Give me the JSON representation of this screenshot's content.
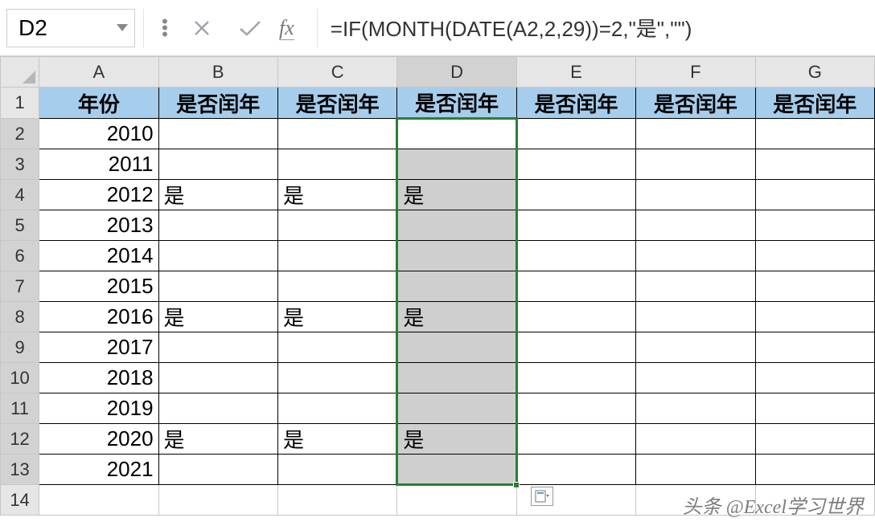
{
  "name_box": "D2",
  "formula_bar": "=IF(MONTH(DATE(A2,2,29))=2,\"是\",\"\")",
  "fx_label": "fx",
  "icons": {
    "cancel": "cancel-icon",
    "confirm": "confirm-icon",
    "dropdown": "dropdown-icon",
    "paste_options": "paste-options-icon"
  },
  "columns": [
    "A",
    "B",
    "C",
    "D",
    "E",
    "F",
    "G"
  ],
  "active_column": "D",
  "row_count": 14,
  "header_row": {
    "A": "年份",
    "B": "是否闰年",
    "C": "是否闰年",
    "D": "是否闰年",
    "E": "是否闰年",
    "F": "是否闰年",
    "G": "是否闰年"
  },
  "data_rows": [
    {
      "A": "2010",
      "B": "",
      "C": "",
      "D": "",
      "E": "",
      "F": "",
      "G": ""
    },
    {
      "A": "2011",
      "B": "",
      "C": "",
      "D": "",
      "E": "",
      "F": "",
      "G": ""
    },
    {
      "A": "2012",
      "B": "是",
      "C": "是",
      "D": "是",
      "E": "",
      "F": "",
      "G": ""
    },
    {
      "A": "2013",
      "B": "",
      "C": "",
      "D": "",
      "E": "",
      "F": "",
      "G": ""
    },
    {
      "A": "2014",
      "B": "",
      "C": "",
      "D": "",
      "E": "",
      "F": "",
      "G": ""
    },
    {
      "A": "2015",
      "B": "",
      "C": "",
      "D": "",
      "E": "",
      "F": "",
      "G": ""
    },
    {
      "A": "2016",
      "B": "是",
      "C": "是",
      "D": "是",
      "E": "",
      "F": "",
      "G": ""
    },
    {
      "A": "2017",
      "B": "",
      "C": "",
      "D": "",
      "E": "",
      "F": "",
      "G": ""
    },
    {
      "A": "2018",
      "B": "",
      "C": "",
      "D": "",
      "E": "",
      "F": "",
      "G": ""
    },
    {
      "A": "2019",
      "B": "",
      "C": "",
      "D": "",
      "E": "",
      "F": "",
      "G": ""
    },
    {
      "A": "2020",
      "B": "是",
      "C": "是",
      "D": "是",
      "E": "",
      "F": "",
      "G": ""
    },
    {
      "A": "2021",
      "B": "",
      "C": "",
      "D": "",
      "E": "",
      "F": "",
      "G": ""
    }
  ],
  "watermark": "头条 @Excel学习世界",
  "colors": {
    "header_fill": "#a6cdec",
    "selection_fill": "#cfcfcf",
    "selection_border": "#2e7d32",
    "grid_header_bg": "#e6e6e6"
  }
}
